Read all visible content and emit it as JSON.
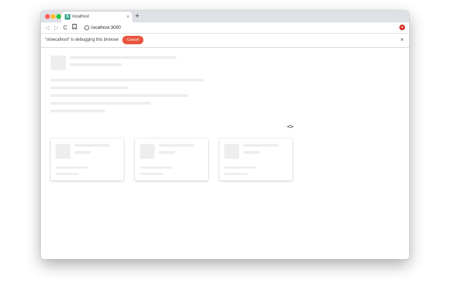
{
  "browser": {
    "tab_title": "localhost",
    "tab_favicon_letter": "S",
    "tab_close": "×",
    "new_tab": "+",
    "url": "localhost:3000",
    "nav": {
      "back": "◁",
      "forward": "▷",
      "reload": "C"
    }
  },
  "infobar": {
    "message": "\"slowcalhost\" is debugging this browser",
    "cancel_label": "Cancel",
    "close": "×"
  },
  "page": {
    "carousel_controls": "<>",
    "card_count": 3
  },
  "colors": {
    "cancel_button": "#e8553e",
    "skeleton": "#eeeeee",
    "tabstrip": "#dee1e6"
  }
}
